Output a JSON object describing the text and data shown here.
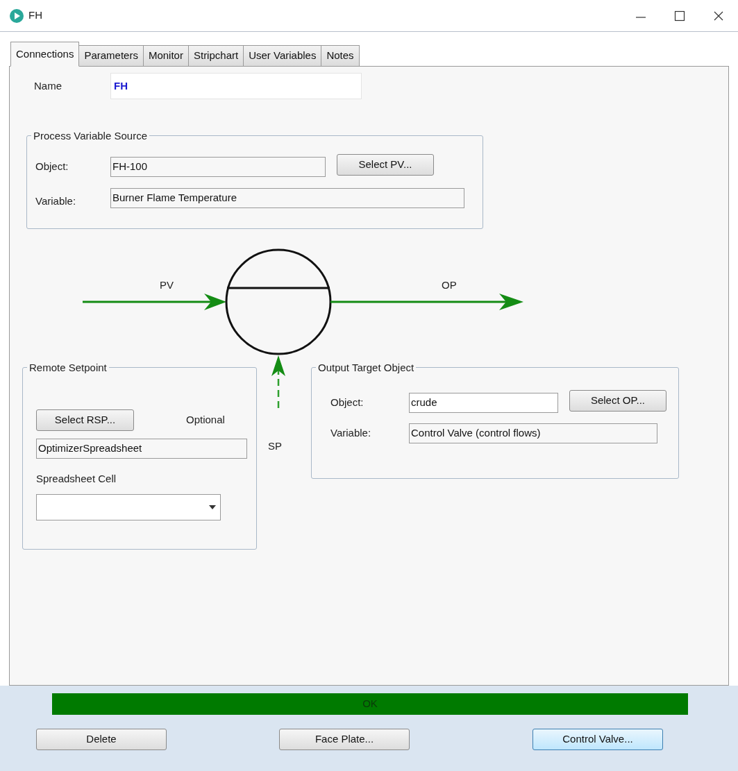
{
  "window": {
    "title": "FH"
  },
  "tabs": [
    {
      "label": "Connections",
      "selected": true
    },
    {
      "label": "Parameters",
      "selected": false
    },
    {
      "label": "Monitor",
      "selected": false
    },
    {
      "label": "Stripchart",
      "selected": false
    },
    {
      "label": "User Variables",
      "selected": false
    },
    {
      "label": "Notes",
      "selected": false
    }
  ],
  "name": {
    "label": "Name",
    "value": "FH"
  },
  "pv_source": {
    "title": "Process Variable Source",
    "object_label": "Object:",
    "object_value": "FH-100",
    "button": "Select PV...",
    "variable_label": "Variable:",
    "variable_value": "Burner Flame Temperature"
  },
  "diagram": {
    "input_label": "PV",
    "output_label": "OP",
    "setpoint_label": "SP"
  },
  "remote_setpoint": {
    "title": "Remote Setpoint",
    "button": "Select RSP...",
    "optional_label": "Optional",
    "object_value": "OptimizerSpreadsheet",
    "cell_label": "Spreadsheet Cell"
  },
  "output_target": {
    "title": "Output Target Object",
    "object_label": "Object:",
    "object_value": "crude",
    "button": "Select OP...",
    "variable_label": "Variable:",
    "variable_value": "Control Valve (control flows)"
  },
  "status": {
    "text": "OK",
    "kind": "ok"
  },
  "buttons": [
    {
      "label": "Delete",
      "default": false
    },
    {
      "label": "Face Plate...",
      "default": false
    },
    {
      "label": "Control Valve...",
      "default": true
    }
  ]
}
